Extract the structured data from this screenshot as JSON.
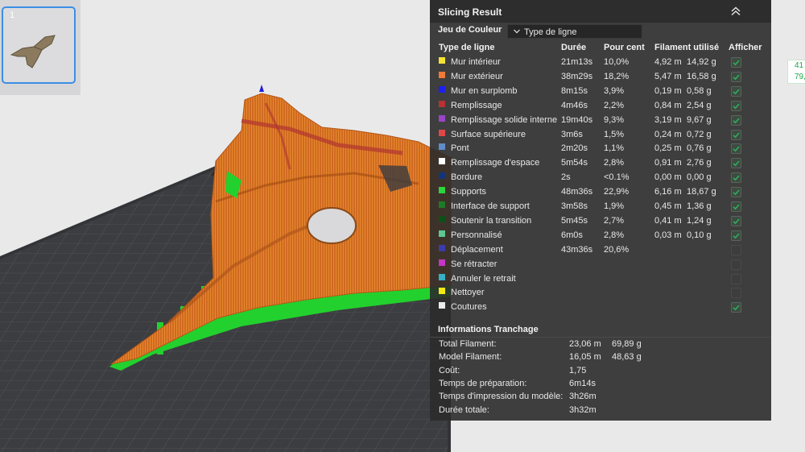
{
  "panel": {
    "title": "Slicing Result",
    "color_scheme_label": "Jeu de Couleur",
    "color_scheme_value": "Type de ligne",
    "headers": {
      "type": "Type de ligne",
      "duration": "Durée",
      "percent": "Pour cent",
      "filament": "Filament utilisé",
      "show": "Afficher"
    },
    "rows": [
      {
        "name": "Mur intérieur",
        "color": "#f4e233",
        "duration": "21m13s",
        "percent": "10,0%",
        "length": "4,92 m",
        "weight": "14,92 g",
        "show": true
      },
      {
        "name": "Mur extérieur",
        "color": "#f07a36",
        "duration": "38m29s",
        "percent": "18,2%",
        "length": "5,47 m",
        "weight": "16,58 g",
        "show": true
      },
      {
        "name": "Mur en surplomb",
        "color": "#1f1ff2",
        "duration": "8m15s",
        "percent": "3,9%",
        "length": "0,19 m",
        "weight": "0,58 g",
        "show": true
      },
      {
        "name": "Remplissage",
        "color": "#b73234",
        "duration": "4m46s",
        "percent": "2,2%",
        "length": "0,84 m",
        "weight": "2,54 g",
        "show": true
      },
      {
        "name": "Remplissage solide interne",
        "color": "#9a45c6",
        "duration": "19m40s",
        "percent": "9,3%",
        "length": "3,19 m",
        "weight": "9,67 g",
        "show": true
      },
      {
        "name": "Surface supérieure",
        "color": "#e04848",
        "duration": "3m6s",
        "percent": "1,5%",
        "length": "0,24 m",
        "weight": "0,72 g",
        "show": true
      },
      {
        "name": "Pont",
        "color": "#5f8cc8",
        "duration": "2m20s",
        "percent": "1,1%",
        "length": "0,25 m",
        "weight": "0,76 g",
        "show": true
      },
      {
        "name": "Remplissage d'espace",
        "color": "#ffffff",
        "duration": "5m54s",
        "percent": "2,8%",
        "length": "0,91 m",
        "weight": "2,76 g",
        "show": true
      },
      {
        "name": "Bordure",
        "color": "#13347a",
        "duration": "2s",
        "percent": "<0.1%",
        "length": "0,00 m",
        "weight": "0,00 g",
        "show": true
      },
      {
        "name": "Supports",
        "color": "#2bd63c",
        "duration": "48m36s",
        "percent": "22,9%",
        "length": "6,16 m",
        "weight": "18,67 g",
        "show": true
      },
      {
        "name": "Interface de support",
        "color": "#1e7a28",
        "duration": "3m58s",
        "percent": "1,9%",
        "length": "0,45 m",
        "weight": "1,36 g",
        "show": true
      },
      {
        "name": "Soutenir la transition",
        "color": "#0f5018",
        "duration": "5m45s",
        "percent": "2,7%",
        "length": "0,41 m",
        "weight": "1,24 g",
        "show": true
      },
      {
        "name": "Personnalisé",
        "color": "#5fc690",
        "duration": "6m0s",
        "percent": "2,8%",
        "length": "0,03 m",
        "weight": "0,10 g",
        "show": true
      },
      {
        "name": "Déplacement",
        "color": "#3c3ca6",
        "duration": "43m36s",
        "percent": "20,6%",
        "length": "",
        "weight": "",
        "show": false
      },
      {
        "name": "Se rétracter",
        "color": "#c436c4",
        "duration": "",
        "percent": "",
        "length": "",
        "weight": "",
        "show": false
      },
      {
        "name": "Annuler le retrait",
        "color": "#35b0c4",
        "duration": "",
        "percent": "",
        "length": "",
        "weight": "",
        "show": false
      },
      {
        "name": "Nettoyer",
        "color": "#f2e814",
        "duration": "",
        "percent": "",
        "length": "",
        "weight": "",
        "show": false
      },
      {
        "name": "Coutures",
        "color": "#ebebeb",
        "duration": "",
        "percent": "",
        "length": "",
        "weight": "",
        "show": true
      }
    ],
    "info_title": "Informations Tranchage",
    "info": [
      {
        "label": "Total Filament:",
        "v1": "23,06 m",
        "v2": "69,89 g"
      },
      {
        "label": "Model Filament:",
        "v1": "16,05 m",
        "v2": "48,63 g"
      },
      {
        "label": "Coût:",
        "v1": "1,75",
        "v2": ""
      },
      {
        "label": "Temps de préparation:",
        "v1": "6m14s",
        "v2": ""
      },
      {
        "label": "Temps d'impression du modèle:",
        "v1": "3h26m",
        "v2": ""
      },
      {
        "label": "Durée totale:",
        "v1": "3h32m",
        "v2": ""
      }
    ]
  },
  "plate": {
    "number": "1"
  },
  "side_stats": {
    "line1": "41",
    "line2": "79,"
  },
  "colors": {
    "accent": "#3b8ee6",
    "support": "#2bd63c",
    "model": "#d86a1e",
    "check": "#2fae59"
  }
}
